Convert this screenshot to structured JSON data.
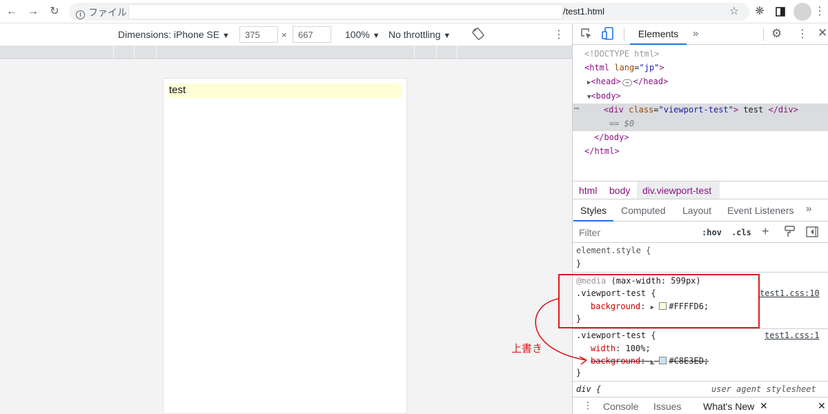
{
  "browser": {
    "site_info_label": "ファイル",
    "url_tail": "/test1.html"
  },
  "device_toolbar": {
    "dimensions_label": "Dimensions: iPhone SE",
    "width": "375",
    "times": "×",
    "height": "667",
    "zoom": "100%",
    "throttling": "No throttling"
  },
  "page": {
    "div_text": "test"
  },
  "devtools": {
    "main_tab": "Elements",
    "dom": {
      "doctype": "<!DOCTYPE html>",
      "html_open_tag": "<html",
      "html_lang_attr": "lang",
      "html_lang_val": "\"jp\"",
      "html_gt": ">",
      "head_open": "<head>",
      "head_close": "</head>",
      "body_open": "<body>",
      "div_open": "<div",
      "div_class_attr": "class",
      "div_class_val": "\"viewport-test\"",
      "div_gt": ">",
      "div_text": " test ",
      "div_close": "</div>",
      "selected_marker": "== $0",
      "body_close": "</body>",
      "html_close": "</html>"
    },
    "breadcrumbs": [
      "html",
      "body",
      "div.viewport-test"
    ],
    "style_tabs": [
      "Styles",
      "Computed",
      "Layout",
      "Event Listeners"
    ],
    "filter_placeholder": "Filter",
    "hov": ":hov",
    "cls": ".cls",
    "rules": {
      "element_style_open": "element.style {",
      "close_brace": "}",
      "media_keyword": "@media",
      "media_query": " (max-width: 599px)",
      "rule1_selector": ".viewport-test {",
      "rule1_source": "test1.css:10",
      "rule1_prop": "background",
      "rule1_value": "#FFFFD6;",
      "rule2_selector": ".viewport-test {",
      "rule2_source": "test1.css:1",
      "rule2_prop1": "width",
      "rule2_value1": "100%;",
      "rule2_prop2": "background",
      "rule2_value2": "#C8E3ED;",
      "ua_selector": "div {",
      "ua_source": "user agent stylesheet"
    },
    "drawer_tabs": [
      "Console",
      "Issues",
      "What's New"
    ]
  },
  "annotation": "上書き",
  "colors": {
    "override_swatch": "#FFFFD6",
    "original_swatch": "#C8E3ED",
    "annotation_red": "#e0181e",
    "accent_blue": "#1a73e8"
  }
}
